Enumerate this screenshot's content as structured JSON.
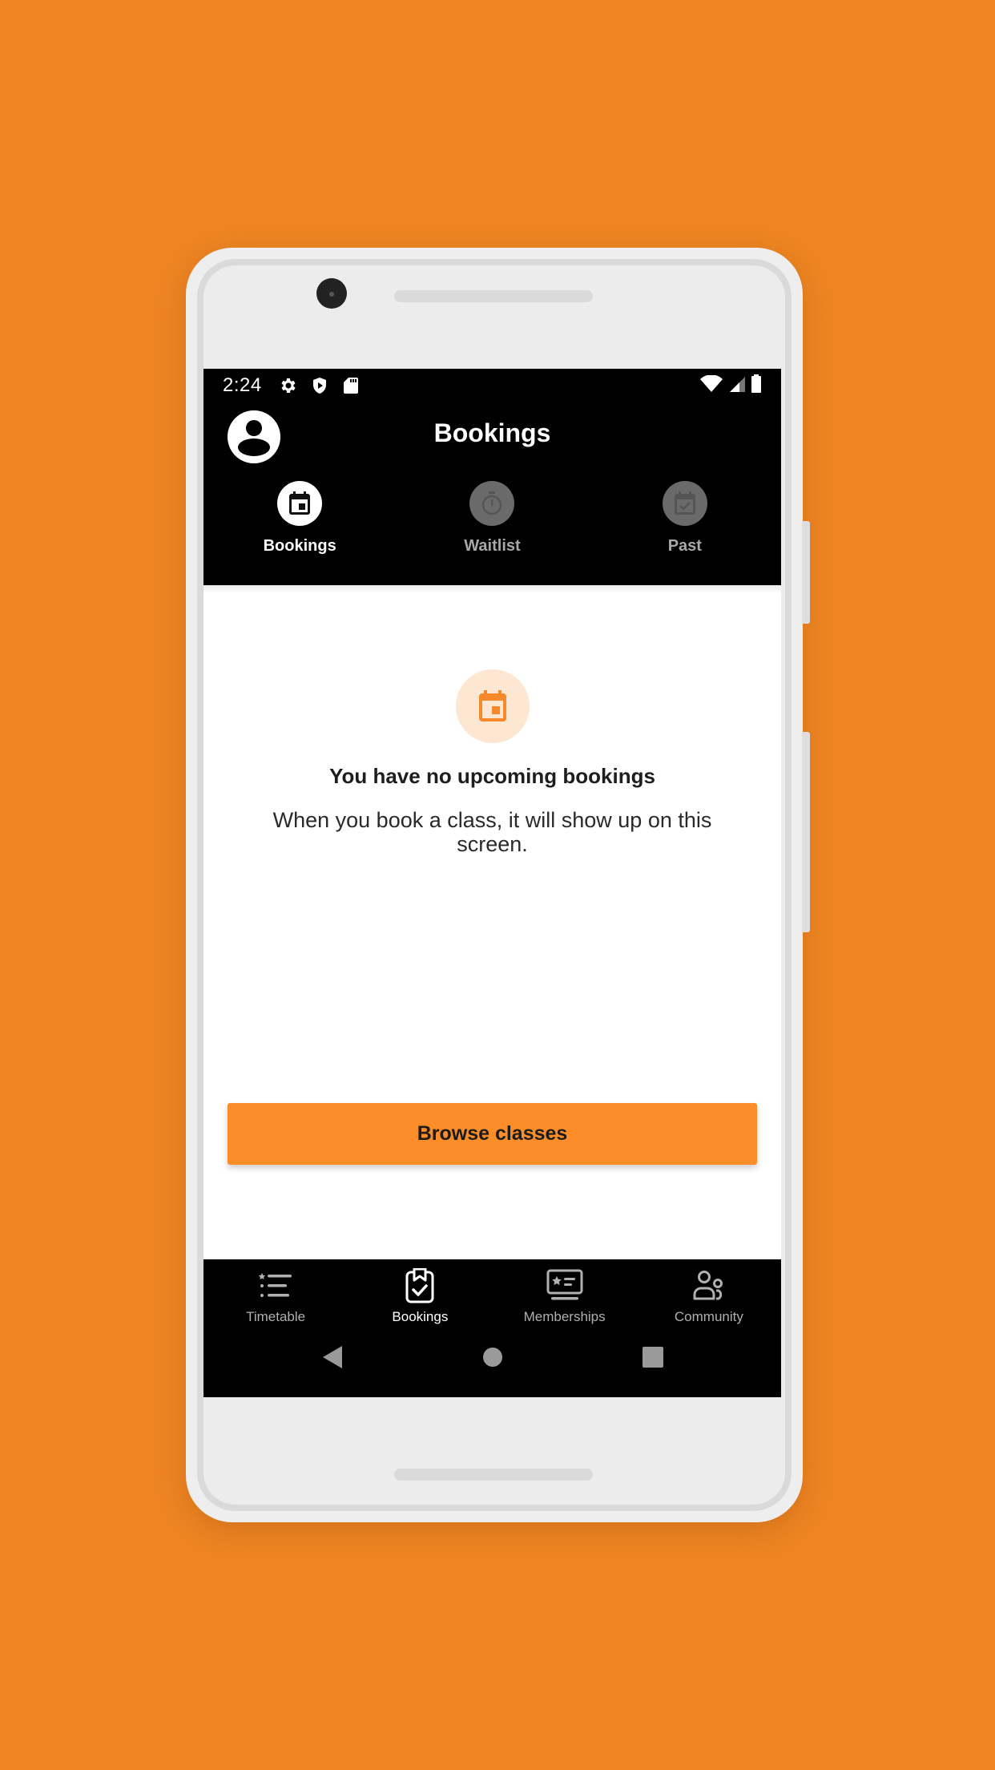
{
  "status_bar": {
    "time": "2:24",
    "left_icons": [
      "settings-icon",
      "play-protect-icon",
      "sd-card-icon"
    ],
    "right_icons": [
      "wifi-icon",
      "cell-signal-icon",
      "battery-icon"
    ]
  },
  "header": {
    "title": "Bookings",
    "avatar_icon": "account-circle-icon"
  },
  "tabs": [
    {
      "label": "Bookings",
      "icon": "calendar-icon",
      "active": true
    },
    {
      "label": "Waitlist",
      "icon": "stopwatch-icon",
      "active": false
    },
    {
      "label": "Past",
      "icon": "calendar-check-icon",
      "active": false
    }
  ],
  "empty_state": {
    "icon": "calendar-icon",
    "title": "You have no upcoming bookings",
    "subtitle": "When you book a class, it will show up on this screen."
  },
  "primary_action": {
    "label": "Browse classes"
  },
  "bottom_nav": [
    {
      "label": "Timetable",
      "icon": "list-star-icon",
      "active": false
    },
    {
      "label": "Bookings",
      "icon": "clipboard-check-icon",
      "active": true
    },
    {
      "label": "Memberships",
      "icon": "membership-card-icon",
      "active": false
    },
    {
      "label": "Community",
      "icon": "people-icon",
      "active": false
    }
  ],
  "system_nav": [
    "back-icon",
    "home-icon",
    "recents-icon"
  ],
  "colors": {
    "background": "#ef8523",
    "accent": "#fd8d28",
    "accent_light": "#fde7d2",
    "header_bg": "#000000",
    "inactive_tab_circle": "#6a6a6a"
  }
}
